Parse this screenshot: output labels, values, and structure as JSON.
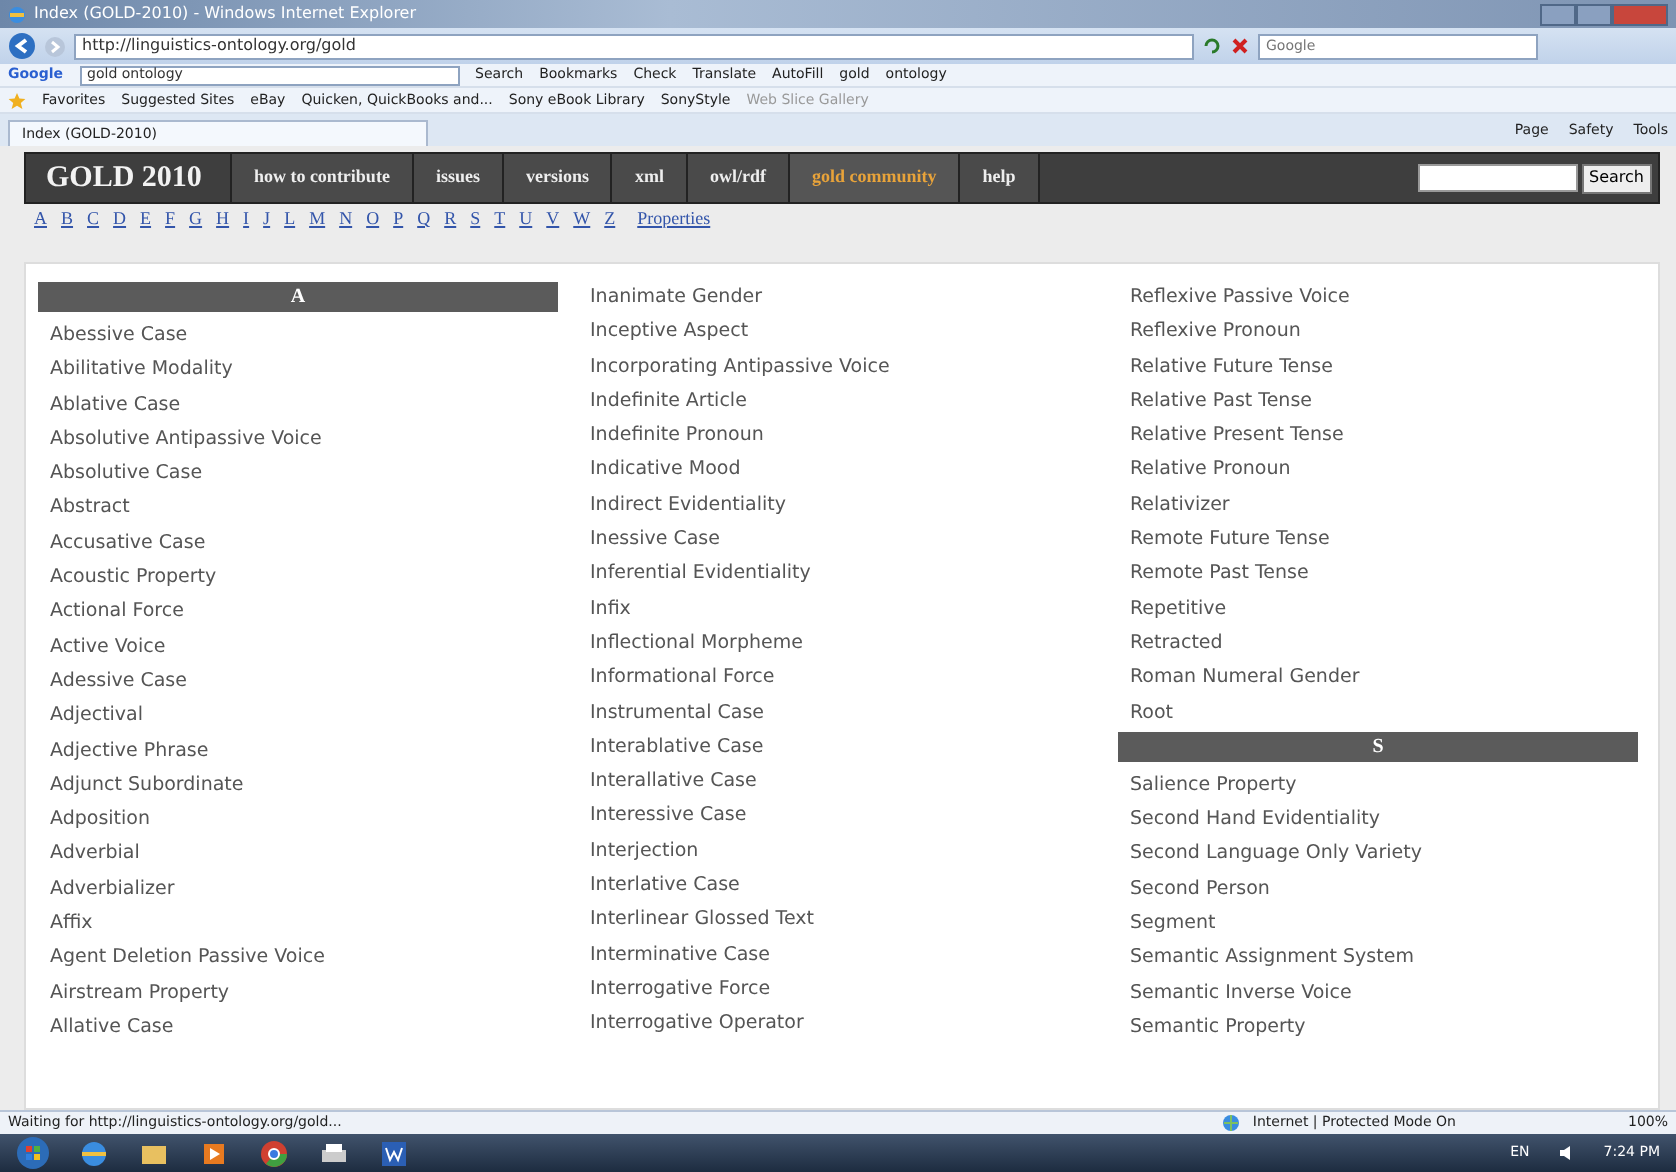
{
  "window": {
    "title": "Index (GOLD-2010) - Windows Internet Explorer"
  },
  "address_bar": {
    "url": "http://linguistics-ontology.org/gold",
    "search_placeholder": "Google"
  },
  "google_toolbar": {
    "logo": "Google",
    "query": "gold ontology",
    "items": [
      "Search",
      "Bookmarks",
      "Check",
      "Translate",
      "AutoFill",
      "gold",
      "ontology"
    ]
  },
  "favorites_bar": {
    "label": "Favorites",
    "items": [
      "Suggested Sites",
      "eBay",
      "Quicken, QuickBooks and...",
      "Sony eBook Library",
      "SonyStyle",
      "Web Slice Gallery"
    ]
  },
  "tabs": [
    {
      "label": "Index (GOLD-2010)",
      "selected": true
    }
  ],
  "command_bar": [
    "Page",
    "Safety",
    "Tools"
  ],
  "site_nav": {
    "brand": "GOLD 2010",
    "links": [
      {
        "label": "how to contribute",
        "selected": false
      },
      {
        "label": "issues",
        "selected": false
      },
      {
        "label": "versions",
        "selected": false
      },
      {
        "label": "xml",
        "selected": false
      },
      {
        "label": "owl/rdf",
        "selected": false
      },
      {
        "label": "gold community",
        "selected": true
      },
      {
        "label": "help",
        "selected": false
      }
    ],
    "search_button": "Search"
  },
  "letters": [
    "A",
    "B",
    "C",
    "D",
    "E",
    "F",
    "G",
    "H",
    "I",
    "J",
    "L",
    "M",
    "N",
    "O",
    "P",
    "Q",
    "R",
    "S",
    "T",
    "U",
    "V",
    "W",
    "Z"
  ],
  "properties_link": "Properties",
  "columns": [
    [
      {
        "kind": "header",
        "label": "A"
      },
      {
        "kind": "term",
        "label": "Abessive Case"
      },
      {
        "kind": "term",
        "label": "Abilitative Modality"
      },
      {
        "kind": "term",
        "label": "Ablative Case"
      },
      {
        "kind": "term",
        "label": "Absolutive Antipassive Voice"
      },
      {
        "kind": "term",
        "label": "Absolutive Case"
      },
      {
        "kind": "term",
        "label": "Abstract"
      },
      {
        "kind": "term",
        "label": "Accusative Case"
      },
      {
        "kind": "term",
        "label": "Acoustic Property"
      },
      {
        "kind": "term",
        "label": "Actional Force"
      },
      {
        "kind": "term",
        "label": "Active Voice"
      },
      {
        "kind": "term",
        "label": "Adessive Case"
      },
      {
        "kind": "term",
        "label": "Adjectival"
      },
      {
        "kind": "term",
        "label": "Adjective Phrase"
      },
      {
        "kind": "term",
        "label": "Adjunct Subordinate"
      },
      {
        "kind": "term",
        "label": "Adposition"
      },
      {
        "kind": "term",
        "label": "Adverbial"
      },
      {
        "kind": "term",
        "label": "Adverbializer"
      },
      {
        "kind": "term",
        "label": "Affix"
      },
      {
        "kind": "term",
        "label": "Agent Deletion Passive Voice"
      },
      {
        "kind": "term",
        "label": "Airstream Property"
      },
      {
        "kind": "term",
        "label": "Allative Case"
      }
    ],
    [
      {
        "kind": "term",
        "label": "Inanimate Gender"
      },
      {
        "kind": "term",
        "label": "Inceptive Aspect"
      },
      {
        "kind": "term",
        "label": "Incorporating Antipassive Voice"
      },
      {
        "kind": "term",
        "label": "Indefinite Article"
      },
      {
        "kind": "term",
        "label": "Indefinite Pronoun"
      },
      {
        "kind": "term",
        "label": "Indicative Mood"
      },
      {
        "kind": "term",
        "label": "Indirect Evidentiality"
      },
      {
        "kind": "term",
        "label": "Inessive Case"
      },
      {
        "kind": "term",
        "label": "Inferential Evidentiality"
      },
      {
        "kind": "term",
        "label": "Infix"
      },
      {
        "kind": "term",
        "label": "Inflectional Morpheme"
      },
      {
        "kind": "term",
        "label": "Informational Force"
      },
      {
        "kind": "term",
        "label": "Instrumental Case"
      },
      {
        "kind": "term",
        "label": "Interablative Case"
      },
      {
        "kind": "term",
        "label": "Interallative Case"
      },
      {
        "kind": "term",
        "label": "Interessive Case"
      },
      {
        "kind": "term",
        "label": "Interjection"
      },
      {
        "kind": "term",
        "label": "Interlative Case"
      },
      {
        "kind": "term",
        "label": "Interlinear Glossed Text"
      },
      {
        "kind": "term",
        "label": "Interminative Case"
      },
      {
        "kind": "term",
        "label": "Interrogative Force"
      },
      {
        "kind": "term",
        "label": "Interrogative Operator"
      }
    ],
    [
      {
        "kind": "term",
        "label": "Reflexive Passive Voice"
      },
      {
        "kind": "term",
        "label": "Reflexive Pronoun"
      },
      {
        "kind": "term",
        "label": "Relative Future Tense"
      },
      {
        "kind": "term",
        "label": "Relative Past Tense"
      },
      {
        "kind": "term",
        "label": "Relative Present Tense"
      },
      {
        "kind": "term",
        "label": "Relative Pronoun"
      },
      {
        "kind": "term",
        "label": "Relativizer"
      },
      {
        "kind": "term",
        "label": "Remote Future Tense"
      },
      {
        "kind": "term",
        "label": "Remote Past Tense"
      },
      {
        "kind": "term",
        "label": "Repetitive"
      },
      {
        "kind": "term",
        "label": "Retracted"
      },
      {
        "kind": "term",
        "label": "Roman Numeral Gender"
      },
      {
        "kind": "term",
        "label": "Root"
      },
      {
        "kind": "header",
        "label": "S"
      },
      {
        "kind": "term",
        "label": "Salience Property"
      },
      {
        "kind": "term",
        "label": "Second Hand Evidentiality"
      },
      {
        "kind": "term",
        "label": "Second Language Only Variety"
      },
      {
        "kind": "term",
        "label": "Second Person"
      },
      {
        "kind": "term",
        "label": "Segment"
      },
      {
        "kind": "term",
        "label": "Semantic Assignment System"
      },
      {
        "kind": "term",
        "label": "Semantic Inverse Voice"
      },
      {
        "kind": "term",
        "label": "Semantic Property"
      }
    ]
  ],
  "status_bar": {
    "text": "Waiting for http://linguistics-ontology.org/gold...",
    "zone": "Internet | Protected Mode On",
    "zoom": "100%"
  },
  "taskbar": {
    "language": "EN",
    "time": "7:24 PM"
  }
}
